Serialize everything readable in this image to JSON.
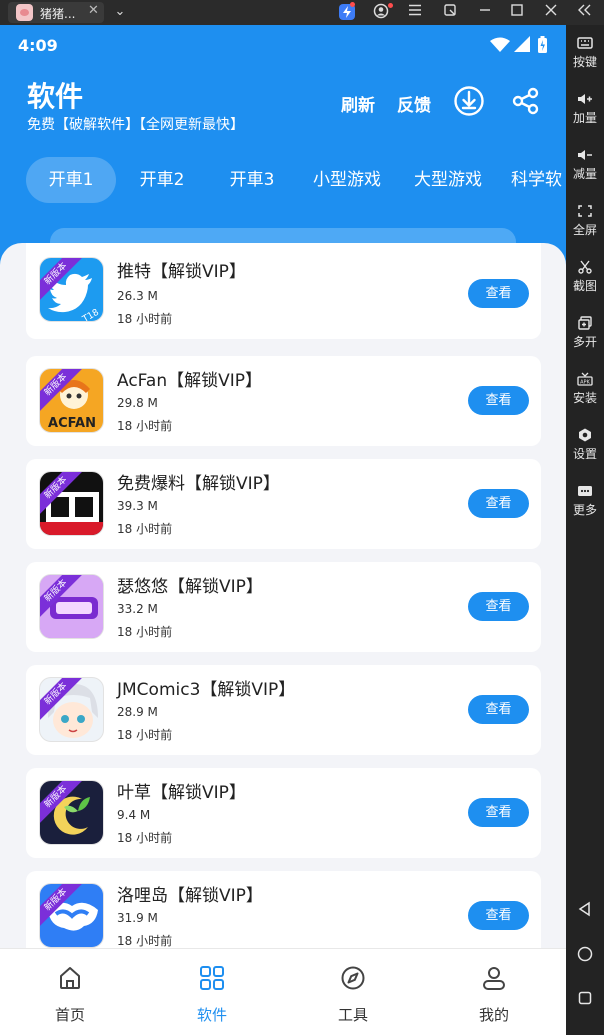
{
  "window": {
    "tab_title": "猪猪...",
    "tab_close": "✕",
    "dropdown": "⌄"
  },
  "sidebar": {
    "items": [
      {
        "label": "按键",
        "icon": "keyboard-icon"
      },
      {
        "label": "加量",
        "icon": "volume-up-icon"
      },
      {
        "label": "减量",
        "icon": "volume-down-icon"
      },
      {
        "label": "全屏",
        "icon": "fullscreen-icon"
      },
      {
        "label": "截图",
        "icon": "scissors-icon"
      },
      {
        "label": "多开",
        "icon": "multi-instance-icon"
      },
      {
        "label": "安装",
        "icon": "apk-install-icon"
      },
      {
        "label": "设置",
        "icon": "settings-icon"
      },
      {
        "label": "更多",
        "icon": "more-icon"
      }
    ]
  },
  "status": {
    "time": "4:09"
  },
  "header": {
    "title": "软件",
    "subtitle": "免费【破解软件】【全网更新最快】",
    "refresh": "刷新",
    "feedback": "反馈"
  },
  "tabs": [
    {
      "label": "开車1",
      "active": true
    },
    {
      "label": "开車2"
    },
    {
      "label": "开車3"
    },
    {
      "label": "小型游戏"
    },
    {
      "label": "大型游戏"
    },
    {
      "label": "科学软"
    }
  ],
  "apps": [
    {
      "name": "推特【解锁VIP】",
      "size": "26.3 M",
      "time": "18 小时前",
      "button": "查看",
      "ribbon": "新版本",
      "color": "#1d9bf0"
    },
    {
      "name": "AcFan【解锁VIP】",
      "size": "29.8 M",
      "time": "18 小时前",
      "button": "查看",
      "ribbon": "新版本",
      "color": "#f5a623"
    },
    {
      "name": "免费爆料【解锁VIP】",
      "size": "39.3 M",
      "time": "18 小时前",
      "button": "查看",
      "ribbon": "新版本",
      "color": "#111111"
    },
    {
      "name": "瑟悠悠【解锁VIP】",
      "size": "33.2 M",
      "time": "18 小时前",
      "button": "查看",
      "ribbon": "新版本",
      "color": "#c48ef0"
    },
    {
      "name": "JMComic3【解锁VIP】",
      "size": "28.9 M",
      "time": "18 小时前",
      "button": "查看",
      "ribbon": "新版本",
      "color": "#eef3f8"
    },
    {
      "name": "叶草【解锁VIP】",
      "size": "9.4 M",
      "time": "18 小时前",
      "button": "查看",
      "ribbon": "新版本",
      "color": "#1a1f3c"
    },
    {
      "name": "洛哩岛【解锁VIP】",
      "size": "31.9 M",
      "time": "18 小时前",
      "button": "查看",
      "ribbon": "新版本",
      "color": "#2f7ef5"
    }
  ],
  "bottom_nav": [
    {
      "label": "首页",
      "icon": "home-icon"
    },
    {
      "label": "软件",
      "icon": "grid-icon",
      "active": true
    },
    {
      "label": "工具",
      "icon": "compass-icon"
    },
    {
      "label": "我的",
      "icon": "user-icon"
    }
  ],
  "colors": {
    "primary": "#1e8ff0",
    "ribbon": "#7b2fd9"
  }
}
